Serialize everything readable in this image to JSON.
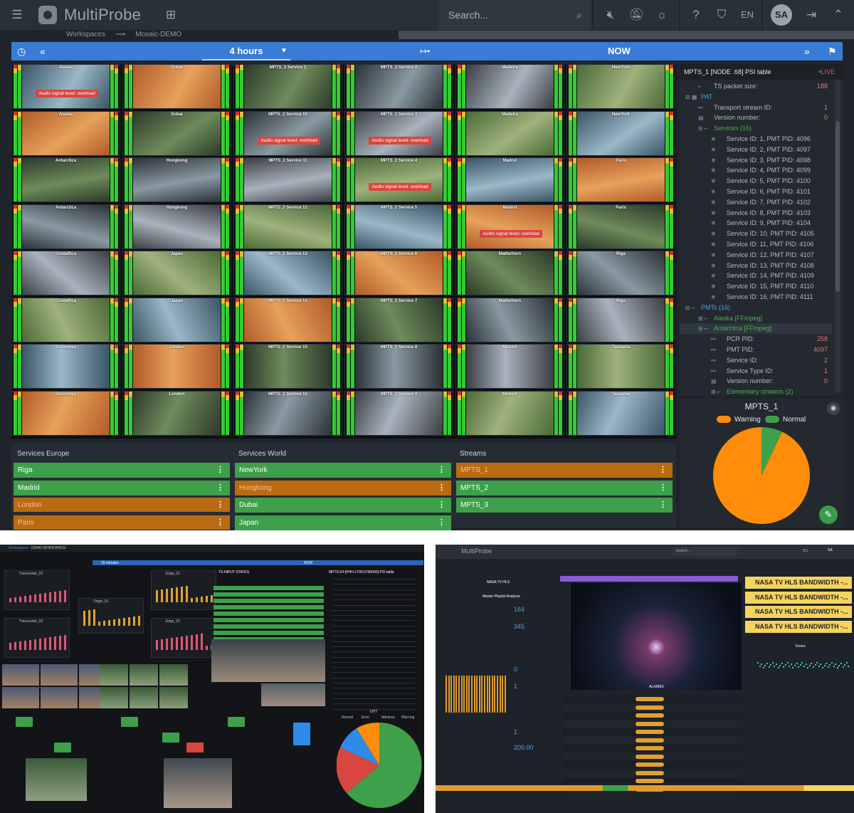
{
  "app": {
    "name": "MultiProbe",
    "lang": "EN",
    "avatar": "SA",
    "search_placeholder": "Search..."
  },
  "breadcrumb": {
    "root": "Workspaces",
    "arrow": "⟶",
    "current": "Mosaic-DEMO"
  },
  "timebar": {
    "range": "4 hours",
    "now": "NOW"
  },
  "mosaic": {
    "columns": [
      [
        "Alaska",
        "Alaska",
        "Antarctica",
        "Antarctica",
        "CostaRica",
        "CostaRica",
        "Dolomites",
        "Dolomites"
      ],
      [
        "Dubai",
        "Dubai",
        "Hongkong",
        "Hongkong",
        "Japan",
        "Japan",
        "London",
        "London"
      ],
      [
        "MPTS_2 Service 1",
        "MPTS_2 Service 10",
        "MPTS_2 Service 11",
        "MPTS_2 Service 12",
        "MPTS_2 Service 13",
        "MPTS_2 Service 14",
        "MPTS_2 Service 15",
        "MPTS_2 Service 16"
      ],
      [
        "MPTS_2 Service 2",
        "MPTS_2 Service 3",
        "MPTS_2 Service 4",
        "MPTS_2 Service 5",
        "MPTS_2 Service 6",
        "MPTS_2 Service 7",
        "MPTS_2 Service 8",
        "MPTS_2 Service 9"
      ],
      [
        "Madeira",
        "Madeira",
        "Madrid",
        "Madrid",
        "Matterhorn",
        "Matterhorn",
        "Munich",
        "Munich"
      ],
      [
        "NewYork",
        "NewYork",
        "Paris",
        "Paris",
        "Riga",
        "Riga",
        "Tanzania",
        "Tanzania"
      ]
    ],
    "alert_text": "Audio signal level: overload",
    "alerts": [
      [
        0,
        0
      ],
      [
        1,
        2
      ],
      [
        1,
        3
      ],
      [
        2,
        3
      ],
      [
        3,
        4
      ],
      [
        4,
        6
      ]
    ]
  },
  "psi": {
    "title": "MPTS_1 [NODE .68] PSI table",
    "live": "•LIVE",
    "rows": [
      {
        "indent": 1,
        "icon": "▪",
        "text": "TS packet size:",
        "val": "188"
      },
      {
        "indent": 0,
        "icon": "⊟ ▦",
        "text": "PAT",
        "cls": "blue"
      },
      {
        "indent": 1,
        "icon": "⚯",
        "text": "Transport stream ID:",
        "val": "1"
      },
      {
        "indent": 1,
        "icon": "▤",
        "text": "Version number:",
        "val": "0"
      },
      {
        "indent": 1,
        "icon": "⊟ ⌐",
        "text": "Services (16)",
        "cls": "green"
      },
      {
        "indent": 2,
        "icon": "❄",
        "text": "Service ID: 1, PMT PID: 4096"
      },
      {
        "indent": 2,
        "icon": "❄",
        "text": "Service ID: 2, PMT PID: 4097"
      },
      {
        "indent": 2,
        "icon": "❄",
        "text": "Service ID: 3, PMT PID: 4098"
      },
      {
        "indent": 2,
        "icon": "❄",
        "text": "Service ID: 4, PMT PID: 4099"
      },
      {
        "indent": 2,
        "icon": "❄",
        "text": "Service ID: 5, PMT PID: 4100"
      },
      {
        "indent": 2,
        "icon": "❄",
        "text": "Service ID: 6, PMT PID: 4101"
      },
      {
        "indent": 2,
        "icon": "❄",
        "text": "Service ID: 7, PMT PID: 4102"
      },
      {
        "indent": 2,
        "icon": "❄",
        "text": "Service ID: 8, PMT PID: 4103"
      },
      {
        "indent": 2,
        "icon": "❄",
        "text": "Service ID: 9, PMT PID: 4104"
      },
      {
        "indent": 2,
        "icon": "❄",
        "text": "Service ID: 10, PMT PID: 4105"
      },
      {
        "indent": 2,
        "icon": "❄",
        "text": "Service ID: 11, PMT PID: 4106"
      },
      {
        "indent": 2,
        "icon": "❄",
        "text": "Service ID: 12, PMT PID: 4107"
      },
      {
        "indent": 2,
        "icon": "❄",
        "text": "Service ID: 13, PMT PID: 4108"
      },
      {
        "indent": 2,
        "icon": "❄",
        "text": "Service ID: 14, PMT PID: 4109"
      },
      {
        "indent": 2,
        "icon": "❄",
        "text": "Service ID: 15, PMT PID: 4110"
      },
      {
        "indent": 2,
        "icon": "❄",
        "text": "Service ID: 16, PMT PID: 4111"
      },
      {
        "indent": 0,
        "icon": "⊟ ⌐",
        "text": "PMTs (16)",
        "cls": "blue"
      },
      {
        "indent": 1,
        "icon": "⊞ ⌐",
        "text": "Alaska [FFmpeg]",
        "cls": "green"
      },
      {
        "indent": 1,
        "icon": "⊟ ⌐",
        "text": "Antarctica [FFmpeg]",
        "cls": "green hl"
      },
      {
        "indent": 2,
        "icon": "⚯",
        "text": "PCR PID:",
        "val": "258"
      },
      {
        "indent": 2,
        "icon": "⚯",
        "text": "PMT PID:",
        "val": "4097"
      },
      {
        "indent": 2,
        "icon": "⚯",
        "text": "Service ID:",
        "val": "2"
      },
      {
        "indent": 2,
        "icon": "⚯",
        "text": "Service Type ID:",
        "val": "1"
      },
      {
        "indent": 2,
        "icon": "▤",
        "text": "Version number:",
        "val": "0"
      },
      {
        "indent": 2,
        "icon": "⊞ ⌐",
        "text": "Elementary streams (2)",
        "cls": "green"
      }
    ]
  },
  "pie": {
    "title": "MPTS_1",
    "legend": [
      {
        "label": "Warning",
        "color": "#ff8c0a"
      },
      {
        "label": "Normal",
        "color": "#3ea04a"
      }
    ]
  },
  "chart_data": {
    "type": "pie",
    "title": "MPTS_1",
    "categories": [
      "Warning",
      "Normal"
    ],
    "values": [
      93,
      7
    ]
  },
  "groups": [
    {
      "title": "Services Europe",
      "items": [
        {
          "label": "Riga",
          "status": "g"
        },
        {
          "label": "Madrid",
          "status": "g"
        },
        {
          "label": "London",
          "status": "o"
        },
        {
          "label": "Paris",
          "status": "o"
        }
      ]
    },
    {
      "title": "Services World",
      "items": [
        {
          "label": "NewYork",
          "status": "g"
        },
        {
          "label": "Hongkong",
          "status": "o"
        },
        {
          "label": "Dubai",
          "status": "g"
        },
        {
          "label": "Japan",
          "status": "g"
        }
      ]
    },
    {
      "title": "Streams",
      "items": [
        {
          "label": "MPTS_1",
          "status": "o"
        },
        {
          "label": "MPTS_2",
          "status": "g"
        },
        {
          "label": "MPTS_3",
          "status": "g"
        }
      ]
    }
  ],
  "shot1": {
    "workspace": "Workspaces",
    "demo": "DEMO WORKSPACE",
    "range": "15 minutes",
    "now": "NOW",
    "inputs": "TS-INPUT STATES",
    "psi": "MPTS-04 [HHH-1700-0790000] PSI table",
    "oti": "OTT",
    "legend": [
      "Normal",
      "Error",
      "Advisory",
      "Warning"
    ],
    "charts": [
      "Transcoder_01",
      "Edge_01",
      "Transcoder_02",
      "Origin_01",
      "Edge_02"
    ]
  },
  "shot2": {
    "app": "MultiProbe",
    "lang": "RU",
    "avatar": "SA",
    "search": "Search...",
    "alarms": [
      "NASA TV HLS BANDWIDTH -...",
      "NASA TV HLS BANDWIDTH -...",
      "NASA TV HLS BANDWIDTH -...",
      "NASA TV HLS BANDWIDTH -..."
    ],
    "title": "NASA TV HLS",
    "sub": "Master Playlist Analyzer",
    "m1": "164",
    "m2": "345",
    "m3": "0",
    "m4": "1",
    "m5": "1",
    "m6": "200.00",
    "alarms_title": "ALARMS",
    "errors_title": "Errors"
  }
}
